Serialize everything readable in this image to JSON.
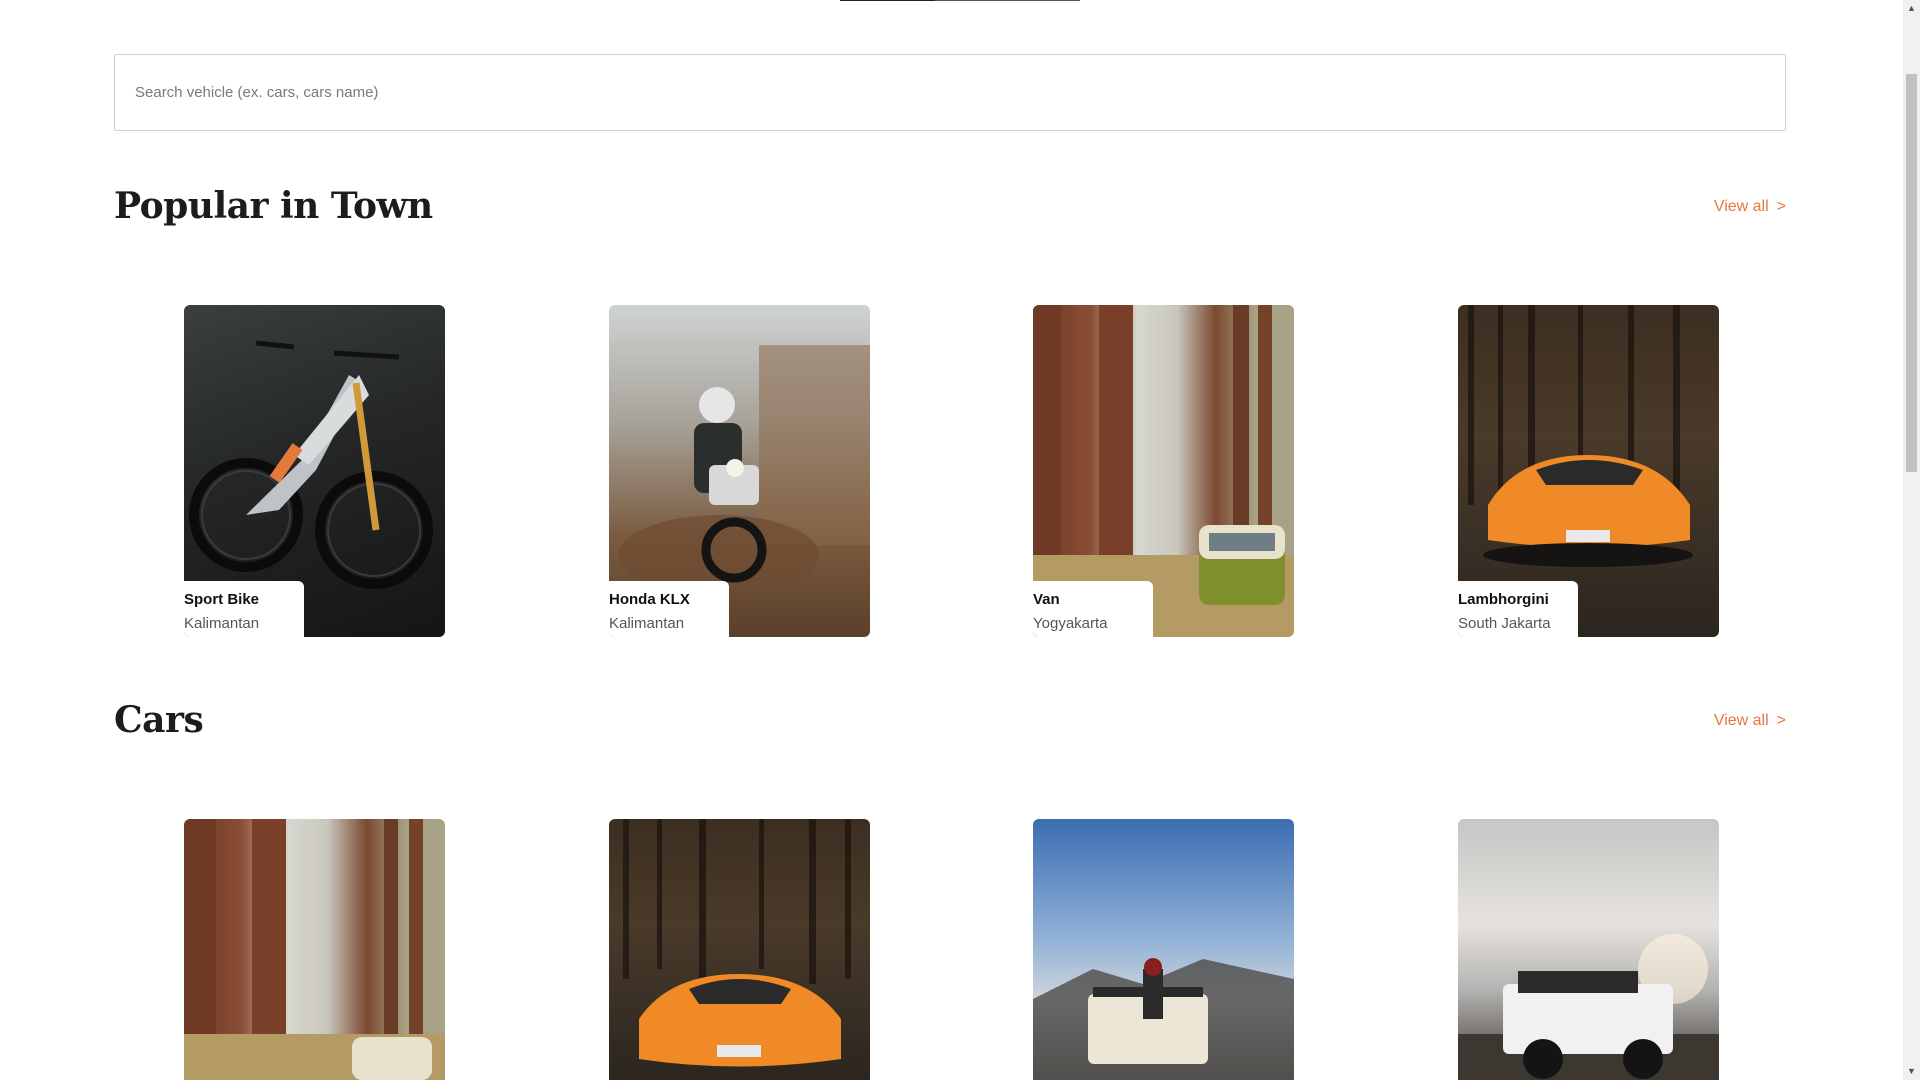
{
  "search": {
    "placeholder": "Search vehicle (ex. cars, cars name)"
  },
  "sections": [
    {
      "title": "Popular in Town",
      "view_all": "View all",
      "arrow": ">",
      "items": [
        {
          "name": "Sport Bike",
          "location": "Kalimantan"
        },
        {
          "name": "Honda KLX",
          "location": "Kalimantan"
        },
        {
          "name": "Van",
          "location": "Yogyakarta"
        },
        {
          "name": "Lambhorgini",
          "location": "South Jakarta"
        }
      ]
    },
    {
      "title": "Cars",
      "view_all": "View all",
      "arrow": ">",
      "items": []
    }
  ],
  "colors": {
    "accent": "#e9773e",
    "text": "#1c1c1c"
  },
  "icons": {
    "scroll_up": "triangle-up-icon",
    "scroll_down": "triangle-down-icon"
  }
}
